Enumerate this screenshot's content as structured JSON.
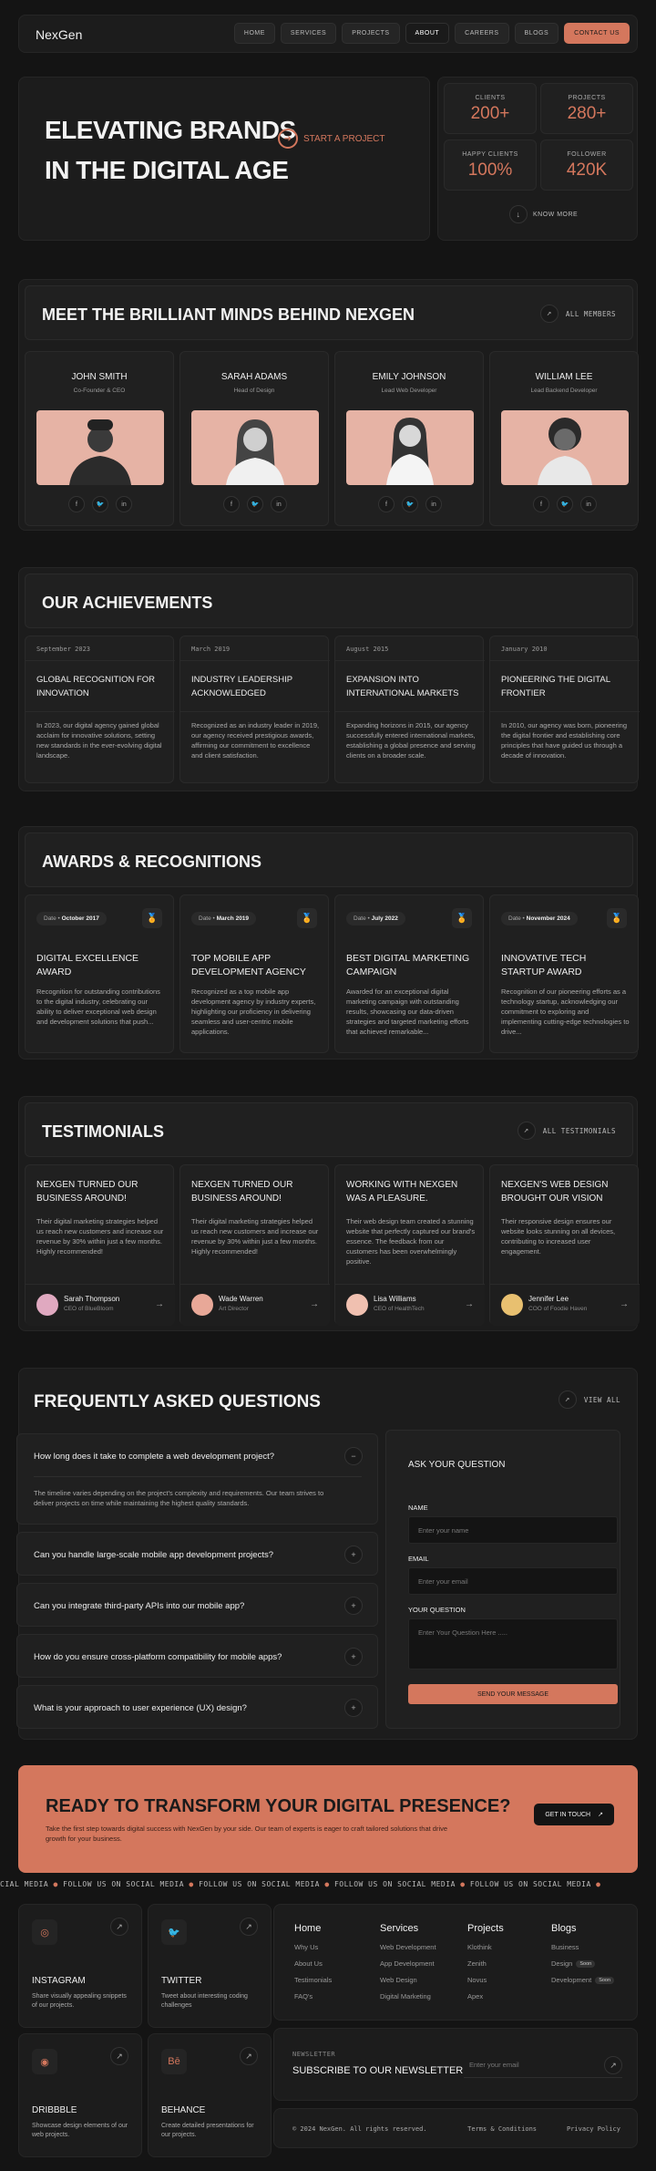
{
  "header": {
    "logo": "NexGen",
    "nav": [
      "HOME",
      "SERVICES",
      "PROJECTS",
      "ABOUT",
      "CAREERS",
      "BLOGS"
    ],
    "contact": "CONTACT US"
  },
  "hero": {
    "line1": "ELEVATING BRANDS",
    "line2": "IN THE DIGITAL AGE",
    "start_project": "START A PROJECT",
    "stats": [
      {
        "label": "CLIENTS",
        "value": "200+"
      },
      {
        "label": "PROJECTS",
        "value": "280+"
      },
      {
        "label": "HAPPY CLIENTS",
        "value": "100%"
      },
      {
        "label": "FOLLOWER",
        "value": "420K"
      }
    ],
    "know_more": "KNOW MORE"
  },
  "team": {
    "title": "MEET THE BRILLIANT MINDS BEHIND NEXGEN",
    "link": "ALL MEMBERS",
    "members": [
      {
        "name": "JOHN SMITH",
        "role": "Co-Founder & CEO"
      },
      {
        "name": "SARAH ADAMS",
        "role": "Head of Design"
      },
      {
        "name": "EMILY JOHNSON",
        "role": "Lead Web Developer"
      },
      {
        "name": "WILLIAM LEE",
        "role": "Lead Backend Developer"
      }
    ]
  },
  "achievements": {
    "title": "OUR ACHIEVEMENTS",
    "items": [
      {
        "date": "September 2023",
        "title": "GLOBAL RECOGNITION FOR INNOVATION",
        "desc": "In 2023, our digital agency gained global acclaim for innovative solutions, setting new standards in the ever-evolving digital landscape."
      },
      {
        "date": "March 2019",
        "title": "INDUSTRY LEADERSHIP ACKNOWLEDGED",
        "desc": "Recognized as an industry leader in 2019, our agency received prestigious awards, affirming our commitment to excellence and client satisfaction."
      },
      {
        "date": "August 2015",
        "title": "EXPANSION INTO INTERNATIONAL MARKETS",
        "desc": "Expanding horizons in 2015, our agency successfully entered international markets, establishing a global presence and serving clients on a broader scale."
      },
      {
        "date": "January 2010",
        "title": "PIONEERING THE DIGITAL FRONTIER",
        "desc": "In 2010, our agency was born, pioneering the digital frontier and establishing core principles that have guided us through a decade of innovation."
      }
    ]
  },
  "awards": {
    "title": "AWARDS & RECOGNITIONS",
    "date_label": "Date •",
    "items": [
      {
        "date": "October 2017",
        "title": "DIGITAL EXCELLENCE AWARD",
        "desc": "Recognition for outstanding contributions to the digital industry, celebrating our ability to deliver exceptional web design and development solutions that push..."
      },
      {
        "date": "March 2019",
        "title": "TOP MOBILE APP DEVELOPMENT AGENCY",
        "desc": "Recognized as a top mobile app development agency by industry experts, highlighting our proficiency in delivering seamless and user-centric mobile applications."
      },
      {
        "date": "July 2022",
        "title": "BEST DIGITAL MARKETING CAMPAIGN",
        "desc": "Awarded for an exceptional digital marketing campaign with outstanding results, showcasing our data-driven strategies and targeted marketing efforts that achieved remarkable..."
      },
      {
        "date": "November 2024",
        "title": "INNOVATIVE TECH STARTUP AWARD",
        "desc": "Recognition of our pioneering efforts as a technology startup, acknowledging our commitment to exploring and implementing cutting-edge technologies to drive..."
      }
    ]
  },
  "testimonials": {
    "title": "TESTIMONIALS",
    "link": "ALL TESTIMONIALS",
    "items": [
      {
        "title": "NEXGEN TURNED OUR BUSINESS AROUND!",
        "desc": "Their digital marketing strategies helped us reach new customers and increase our revenue by 30% within just a few months. Highly recommended!",
        "name": "Sarah Thompson",
        "role": "CEO of BlueBloom"
      },
      {
        "title": "NEXGEN TURNED OUR BUSINESS AROUND!",
        "desc": "Their digital marketing strategies helped us reach new customers and increase our revenue by 30% within just a few months. Highly recommended!",
        "name": "Wade Warren",
        "role": "Art Director"
      },
      {
        "title": "WORKING WITH NEXGEN WAS A PLEASURE.",
        "desc": "Their web design team created a stunning website that perfectly captured our brand's essence. The feedback from our customers has been overwhelmingly positive.",
        "name": "Lisa Williams",
        "role": "CEO of HealthTech"
      },
      {
        "title": "NEXGEN'S WEB DESIGN BROUGHT OUR VISION",
        "desc": "Their responsive design ensures our website looks stunning on all devices, contributing to increased user engagement.",
        "name": "Jennifer Lee",
        "role": "COO of Foodie Haven"
      }
    ]
  },
  "faq": {
    "title": "FREQUENTLY ASKED QUESTIONS",
    "link": "VIEW ALL",
    "items": [
      {
        "q": "How long does it take to complete a web development project?",
        "a": "The timeline varies depending on the project's complexity and requirements. Our team strives to deliver projects on time while maintaining the highest quality standards.",
        "toggle": "−"
      },
      {
        "q": "Can you handle large-scale mobile app development projects?",
        "toggle": "+"
      },
      {
        "q": "Can you integrate third-party APIs into our mobile app?",
        "toggle": "+"
      },
      {
        "q": "How do you ensure cross-platform compatibility for mobile apps?",
        "toggle": "+"
      },
      {
        "q": "What is your approach to user experience (UX) design?",
        "toggle": "+"
      }
    ],
    "form": {
      "title": "ASK YOUR QUESTION",
      "name_label": "NAME",
      "name_placeholder": "Enter your name",
      "email_label": "EMAIL",
      "email_placeholder": "Enter your email",
      "question_label": "YOUR QUESTION",
      "question_placeholder": "Enter Your Question Here .....",
      "submit": "SEND YOUR MESSAGE"
    }
  },
  "cta": {
    "title": "READY TO TRANSFORM YOUR DIGITAL PRESENCE?",
    "desc": "Take the first step towards digital success with NexGen by your side. Our team of experts is eager to craft tailored solutions that drive growth for your business.",
    "button": "GET IN TOUCH"
  },
  "marquee": "FOLLOW US ON SOCIAL MEDIA",
  "marquee_lead": "CIAL MEDIA",
  "socials": [
    {
      "name": "INSTAGRAM",
      "desc": "Share visually appealing snippets of our projects.",
      "icon": "instagram-icon"
    },
    {
      "name": "TWITTER",
      "desc": "Tweet about interesting coding challenges",
      "icon": "twitter-icon"
    },
    {
      "name": "DRIBBBLE",
      "desc": "Showcase design elements of our web projects.",
      "icon": "dribbble-icon"
    },
    {
      "name": "BEHANCE",
      "desc": "Create detailed presentations for our projects.",
      "icon": "behance-icon"
    }
  ],
  "footer": {
    "cols": [
      {
        "heading": "Home",
        "links": [
          {
            "t": "Why Us"
          },
          {
            "t": "About Us"
          },
          {
            "t": "Testimonials"
          },
          {
            "t": "FAQ's"
          }
        ]
      },
      {
        "heading": "Services",
        "links": [
          {
            "t": "Web Development"
          },
          {
            "t": "App Development"
          },
          {
            "t": "Web Design"
          },
          {
            "t": "Digital Marketing"
          }
        ]
      },
      {
        "heading": "Projects",
        "links": [
          {
            "t": "Klothink"
          },
          {
            "t": "Zenith"
          },
          {
            "t": "Novus"
          },
          {
            "t": "Apex"
          }
        ]
      },
      {
        "heading": "Blogs",
        "links": [
          {
            "t": "Business"
          },
          {
            "t": "Design",
            "badge": "Soon"
          },
          {
            "t": "Development",
            "badge": "Soon"
          }
        ]
      }
    ],
    "newsletter_label": "NEWSLETTER",
    "newsletter_title": "SUBSCRIBE TO OUR NEWSLETTER",
    "newsletter_placeholder": "Enter your email",
    "copyright": "© 2024 NexGen. All rights reserved.",
    "terms": "Terms & Conditions",
    "privacy": "Privacy Policy"
  },
  "colors": {
    "accent": "#d4775d",
    "bg": "#141414",
    "card": "#1c1c1c"
  }
}
